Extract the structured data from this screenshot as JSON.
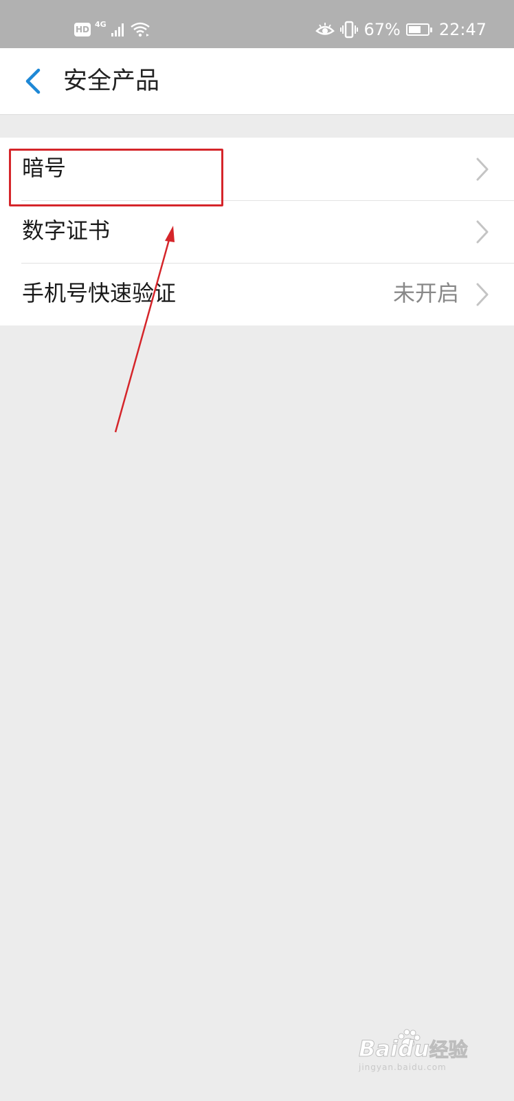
{
  "status_bar": {
    "hd_label": "HD",
    "network_label": "4G",
    "battery_percent": "67%",
    "battery_level": 0.67,
    "time": "22:47"
  },
  "header": {
    "title": "安全产品"
  },
  "menu": {
    "items": [
      {
        "label": "暗号",
        "status": ""
      },
      {
        "label": "数字证书",
        "status": ""
      },
      {
        "label": "手机号快速验证",
        "status": "未开启"
      }
    ]
  },
  "colors": {
    "accent": "#1e88d6",
    "annotation": "#d5252a",
    "status_bar_bg": "#b1b1b1",
    "page_bg": "#ececec"
  },
  "watermark": {
    "logo_text": "Baidu",
    "logo_cn": "经验",
    "url": "jingyan.baidu.com"
  }
}
